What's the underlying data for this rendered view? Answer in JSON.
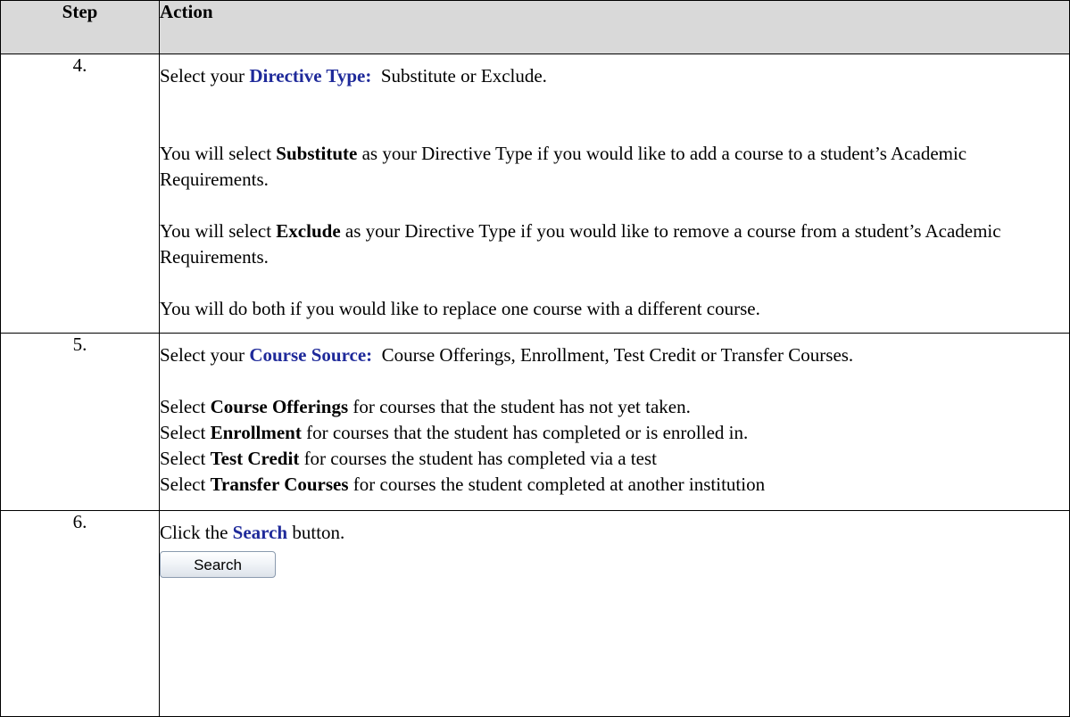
{
  "header": {
    "step": "Step",
    "action": "Action"
  },
  "rows": [
    {
      "num": "4.",
      "l1_pre": "Select your ",
      "l1_kw": "Directive Type:",
      "l1_post": "  Substitute or Exclude.",
      "p2_pre": "You will select ",
      "p2_kw": "Substitute",
      "p2_post": " as your Directive Type if you would like to add a course to a student’s Academic Requirements.",
      "p3_pre": "You will select ",
      "p3_kw": "Exclude",
      "p3_post": " as your Directive Type if you would like to remove a course from a student’s Academic Requirements.",
      "p4": "You will do both if you would like to replace one course with a different course."
    },
    {
      "num": "5.",
      "l1_pre": "Select your ",
      "l1_kw": "Course Source:",
      "l1_post": "  Course Offerings, Enrollment, Test Credit or Transfer Courses.",
      "items": [
        {
          "pre": "Select ",
          "kw": "Course Offerings",
          "post": " for courses that the student has not yet taken."
        },
        {
          "pre": "Select ",
          "kw": "Enrollment",
          "post": " for courses that the student has completed or is enrolled in."
        },
        {
          "pre": "Select ",
          "kw": "Test Credit",
          "post": " for courses the student has completed via a test"
        },
        {
          "pre": "Select ",
          "kw": "Transfer Courses",
          "post": " for courses the student completed at another institution"
        }
      ]
    },
    {
      "num": "6.",
      "l1_pre": "Click the ",
      "l1_kw": "Search",
      "l1_post": " button.",
      "button_label": "Search"
    }
  ]
}
